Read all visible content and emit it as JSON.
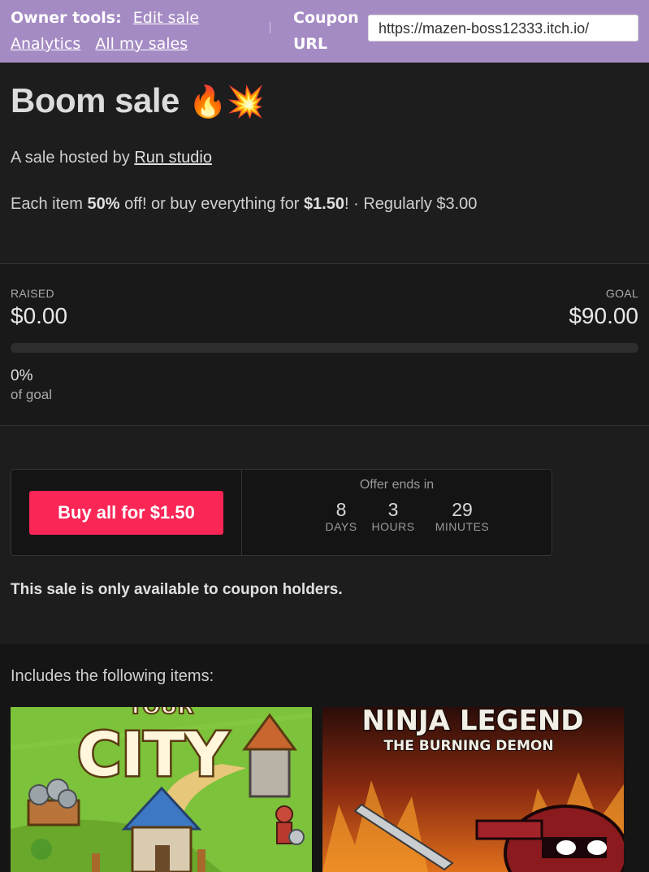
{
  "owner_bar": {
    "label": "Owner tools:",
    "links": [
      "Edit sale",
      "Analytics",
      "All my sales"
    ],
    "coupon_label": "Coupon URL",
    "coupon_url": "https://mazen-boss12333.itch.io/"
  },
  "sale": {
    "title": "Boom sale",
    "title_emojis": "🔥💥",
    "hosted_prefix": "A sale hosted by ",
    "host": "Run studio",
    "pricing_prefix": "Each item ",
    "discount": "50%",
    "pricing_mid": " off! or buy everything for ",
    "bundle_price": "$1.50",
    "pricing_suffix": "! · Regularly $3.00"
  },
  "goal": {
    "raised_label": "RAISED",
    "raised_value": "$0.00",
    "goal_label": "GOAL",
    "goal_value": "$90.00",
    "progress_fraction": 0.0,
    "percent_text": "0%",
    "of_goal_text": "of goal"
  },
  "buy": {
    "button_label": "Buy all for $1.50",
    "offer_label": "Offer ends in",
    "countdown": [
      {
        "value": "8",
        "unit": "DAYS"
      },
      {
        "value": "3",
        "unit": "HOURS"
      },
      {
        "value": "29",
        "unit": "MINUTES"
      }
    ]
  },
  "coupon_note": "This sale is only available to coupon holders.",
  "items": {
    "heading": "Includes the following items:",
    "list": [
      {
        "art_text": "CITY",
        "art_top_text": "YOUR"
      },
      {
        "art_text": "NINJA LEGEND",
        "art_subtitle": "THE BURNING DEMON"
      }
    ]
  },
  "colors": {
    "owner_bar": "#a58bc4",
    "buy_button": "#fa2656",
    "background": "#1d1d1d"
  }
}
